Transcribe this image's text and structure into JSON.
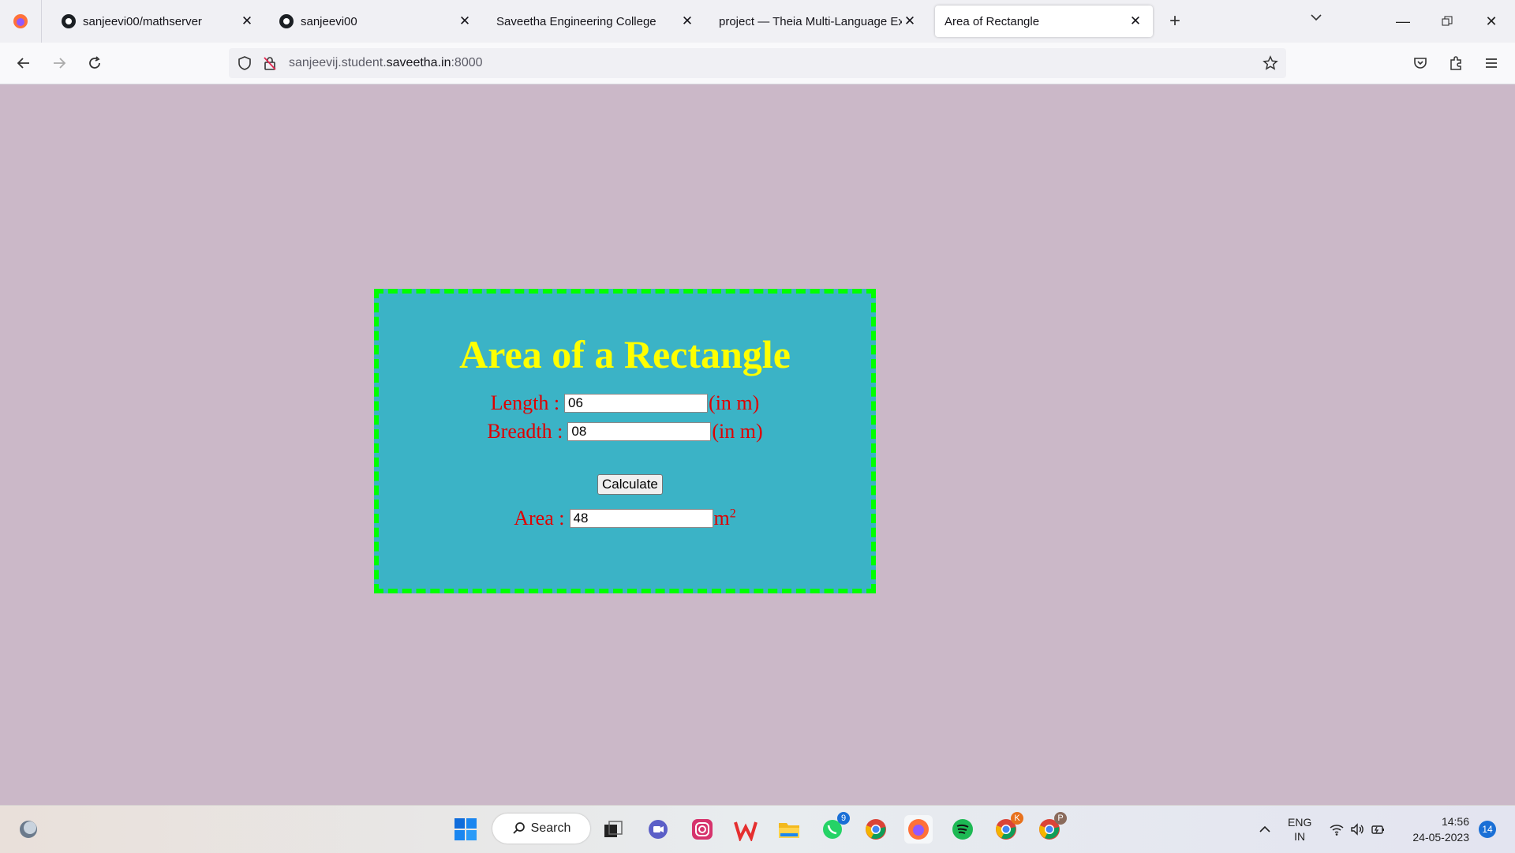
{
  "browser": {
    "tabs": [
      {
        "title": "sanjeevi00/mathserver",
        "icon": "github-icon",
        "active": false
      },
      {
        "title": "sanjeevi00",
        "icon": "github-icon",
        "active": false
      },
      {
        "title": "Saveetha Engineering College",
        "icon": "",
        "active": false
      },
      {
        "title": "project — Theia Multi-Language Ex",
        "icon": "",
        "active": false
      },
      {
        "title": "Area of Rectangle",
        "icon": "",
        "active": true
      }
    ],
    "url_prefix": "sanjeevij.student.",
    "url_domain": "saveetha.in",
    "url_suffix": ":8000"
  },
  "page": {
    "heading": "Area of a Rectangle",
    "length_label": "Length :",
    "length_value": "06",
    "length_unit": "(in m)",
    "breadth_label": "Breadth :",
    "breadth_value": "08",
    "breadth_unit": "(in m)",
    "calculate_label": "Calculate",
    "area_label": "Area :",
    "area_value": "48",
    "area_unit": "m",
    "area_unit_sup": "2",
    "colors": {
      "background": "#cbb8c8",
      "box": "#3bb3c6",
      "border": "#00ff00",
      "heading": "#ffff00",
      "label": "#e00000"
    }
  },
  "taskbar": {
    "search_label": "Search",
    "whatsapp_badge": "9",
    "chrome_profile_k": "K",
    "chrome_profile_p": "P",
    "lang_top": "ENG",
    "lang_bottom": "IN",
    "time": "14:56",
    "date": "24-05-2023",
    "notification_count": "14"
  }
}
